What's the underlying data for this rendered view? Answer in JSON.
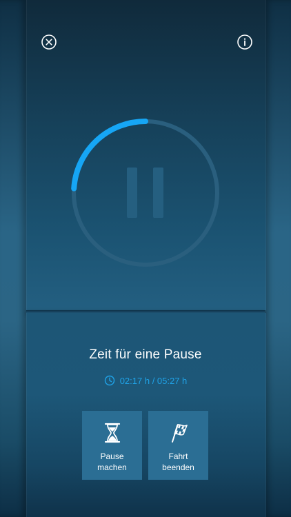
{
  "header": {
    "close_icon": "close-circle-icon",
    "info_icon": "info-circle-icon"
  },
  "timer": {
    "progress_fraction": 0.24,
    "state_icon": "pause-icon",
    "accent_color": "#16a6f5",
    "track_color": "#2a5f7e"
  },
  "main": {
    "title": "Zeit für eine Pause",
    "time_text": "02:17 h / 05:27 h",
    "time_icon": "clock-icon"
  },
  "actions": [
    {
      "label_line1": "Pause",
      "label_line2": "machen",
      "icon": "hourglass-icon"
    },
    {
      "label_line1": "Fahrt",
      "label_line2": "beenden",
      "icon": "checkered-flag-icon"
    }
  ]
}
